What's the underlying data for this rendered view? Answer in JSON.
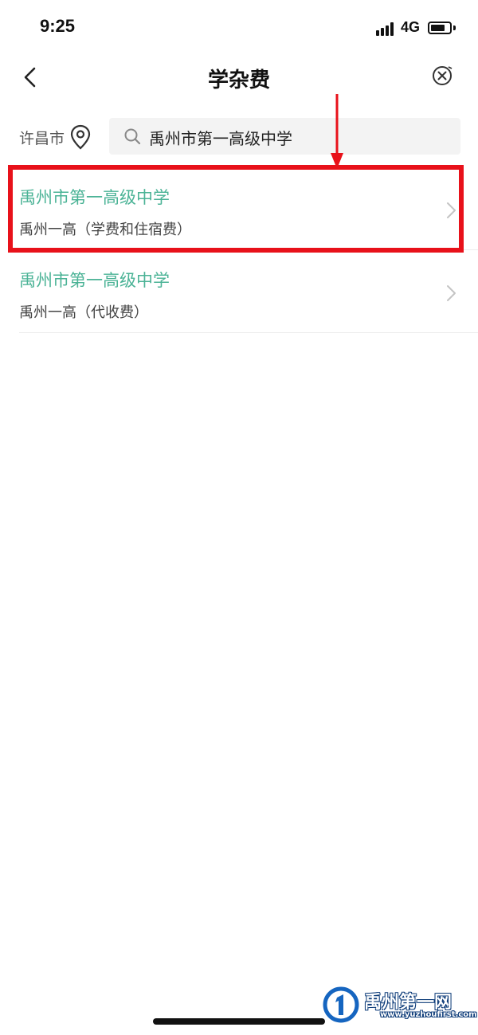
{
  "status_bar": {
    "time": "9:25",
    "network": "4G",
    "icons": [
      "signal-icon",
      "battery-icon"
    ]
  },
  "nav": {
    "title": "学杂费",
    "back_icon": "chevron-left-icon",
    "close_icon": "close-circle-icon"
  },
  "location": {
    "city": "许昌市",
    "icon": "location-pin-icon"
  },
  "search": {
    "value": "禹州市第一高级中学",
    "icon": "search-icon"
  },
  "results": [
    {
      "title": "禹州市第一高级中学",
      "subtitle": "禹州一高（学费和住宿费）",
      "highlighted": true
    },
    {
      "title": "禹州市第一高级中学",
      "subtitle": "禹州一高（代收费）",
      "highlighted": false
    }
  ],
  "annotation": {
    "color": "#e8111a",
    "icon": "arrow-down-icon"
  },
  "watermark": {
    "name": "禹州第一网",
    "url": "www.yuzhoufirst.com"
  },
  "colors": {
    "accent_green": "#4bb396",
    "highlight_red": "#e8111a",
    "search_bg": "#f3f3f3"
  }
}
